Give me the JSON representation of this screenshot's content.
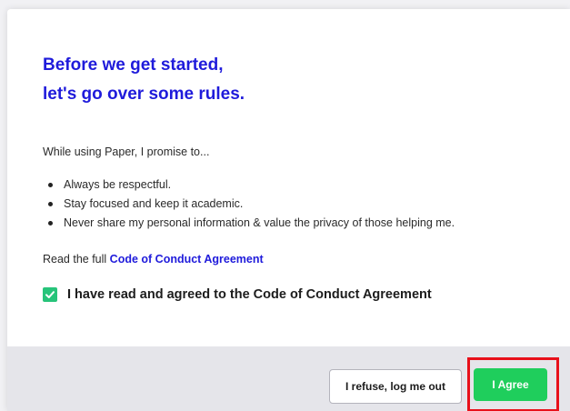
{
  "modal": {
    "title_line1": "Before we get started,",
    "title_line2": "let's go over some rules.",
    "intro": "While using Paper, I promise to...",
    "rules": [
      "Always be respectful.",
      "Stay focused and keep it academic.",
      "Never share my personal information & value the privacy of those helping me."
    ],
    "read_full_prefix": "Read the full ",
    "read_full_link": "Code of Conduct Agreement",
    "agreement_checkbox": {
      "checked": true,
      "label": "I have read and agreed to the Code of Conduct Agreement",
      "icon": "checkmark-icon"
    }
  },
  "footer": {
    "refuse_label": "I refuse, log me out",
    "agree_label": "I Agree"
  },
  "colors": {
    "title": "#1f1bdb",
    "link": "#1f1bdb",
    "checkbox": "#27c47a",
    "agree_button": "#1fce5c",
    "highlight_border": "#e8101a",
    "footer_bg": "#e5e5ea"
  }
}
